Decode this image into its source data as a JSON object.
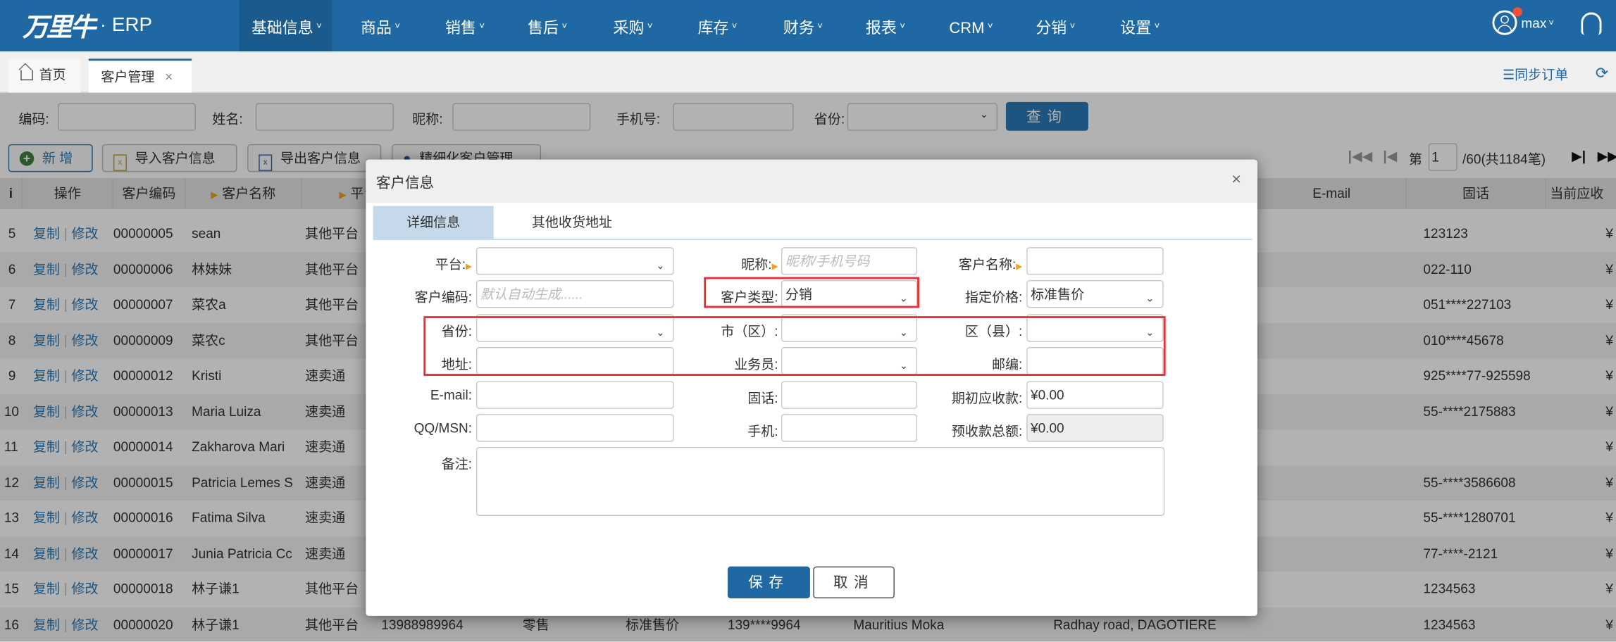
{
  "brand": {
    "logo_text": "万里牛",
    "suffix": "· ERP",
    "color": "#2068a3"
  },
  "nav": [
    {
      "label": "基础信息",
      "active": true
    },
    {
      "label": "商品"
    },
    {
      "label": "销售"
    },
    {
      "label": "售后"
    },
    {
      "label": "采购"
    },
    {
      "label": "库存"
    },
    {
      "label": "财务"
    },
    {
      "label": "报表"
    },
    {
      "label": "CRM"
    },
    {
      "label": "分销"
    },
    {
      "label": "设置"
    }
  ],
  "user": {
    "name": "max",
    "icon": "user-icon",
    "notification": true,
    "support_icon": "headset-icon"
  },
  "tabs": [
    {
      "label": "首页",
      "icon": "home-icon"
    },
    {
      "label": "客户管理",
      "active": true,
      "close": "×"
    }
  ],
  "tabbar_right": {
    "sync_label": "☰同步订单",
    "refresh_icon": "refresh-icon"
  },
  "search": {
    "code_label": "编码:",
    "name_label": "姓名:",
    "nick_label": "昵称:",
    "phone_label": "手机号:",
    "province_label": "省份:",
    "query_button": "查询"
  },
  "toolbar": {
    "add": "新 增",
    "import": "导入客户信息",
    "export": "导出客户信息",
    "fine": "精细化客户管理"
  },
  "pager": {
    "prefix": "第",
    "page": "1",
    "suffix": "/60(共1184笔)"
  },
  "table": {
    "headers": {
      "i": "i",
      "ops": "操作",
      "code": "客户编码",
      "name": "客户名称",
      "platform": "平台",
      "email": "E-mail",
      "tel": "固话",
      "receivable": "当前应收"
    },
    "copy_label": "复制",
    "edit_label": "修改",
    "rows": [
      {
        "i": "5",
        "code": "00000005",
        "name": "sean",
        "platform": "其他平台",
        "tel": "123123",
        "receivable": "¥"
      },
      {
        "i": "6",
        "code": "00000006",
        "name": "林妹妹",
        "platform": "其他平台",
        "tel": "022-110",
        "receivable": "¥"
      },
      {
        "i": "7",
        "code": "00000007",
        "name": "菜农a",
        "platform": "其他平台",
        "tel": "051****227103",
        "receivable": "¥"
      },
      {
        "i": "8",
        "code": "00000009",
        "name": "菜农c",
        "platform": "其他平台",
        "tel": "010****45678",
        "receivable": "¥"
      },
      {
        "i": "9",
        "code": "00000012",
        "name": "Kristi",
        "platform": "速卖通",
        "tel": "925****77-925598",
        "receivable": "¥"
      },
      {
        "i": "10",
        "code": "00000013",
        "name": "Maria Luiza",
        "platform": "速卖通",
        "tel": "55-****2175883",
        "receivable": "¥"
      },
      {
        "i": "11",
        "code": "00000014",
        "name": "Zakharova Mari",
        "platform": "速卖通",
        "tel": "",
        "receivable": "¥"
      },
      {
        "i": "12",
        "code": "00000015",
        "name": "Patricia Lemes S",
        "platform": "速卖通",
        "tel": "55-****3586608",
        "receivable": "¥"
      },
      {
        "i": "13",
        "code": "00000016",
        "name": "Fatima Silva",
        "platform": "速卖通",
        "tel": "55-****1280701",
        "receivable": "¥"
      },
      {
        "i": "14",
        "code": "00000017",
        "name": "Junia Patricia Cc",
        "platform": "速卖通",
        "tel": "77-****-2121",
        "receivable": "¥"
      },
      {
        "i": "15",
        "code": "00000018",
        "name": "林子谦1",
        "platform": "其他平台",
        "tel": "1234563",
        "receivable": "¥"
      },
      {
        "i": "16",
        "code": "00000020",
        "name": "林子谦1",
        "platform": "其他平台",
        "phone": "13988989964",
        "type": "零售",
        "price": "标准售价",
        "mobile": "139****9964",
        "region": "Mauritius Moka",
        "address": "Radhay road, DAGOTIERE",
        "tel": "1234563",
        "receivable": "¥"
      }
    ]
  },
  "dialog": {
    "title": "客户信息",
    "close": "×",
    "tabs": [
      {
        "label": "详细信息",
        "active": true
      },
      {
        "label": "其他收货地址"
      }
    ],
    "fields": {
      "platform": {
        "label": "平台:",
        "value": "",
        "required": true
      },
      "nickname": {
        "label": "昵称:",
        "placeholder": "昵称/手机号码",
        "required": true
      },
      "customer_name": {
        "label": "客户名称:",
        "value": "",
        "required": true
      },
      "customer_code": {
        "label": "客户编码:",
        "placeholder": "默认自动生成......"
      },
      "customer_type": {
        "label": "客户类型:",
        "value": "分销"
      },
      "price": {
        "label": "指定价格:",
        "value": "标准售价"
      },
      "province": {
        "label": "省份:",
        "value": ""
      },
      "city": {
        "label": "市（区）:",
        "value": ""
      },
      "district": {
        "label": "区（县）:",
        "value": ""
      },
      "address": {
        "label": "地址:",
        "value": ""
      },
      "salesman": {
        "label": "业务员:",
        "value": ""
      },
      "zipcode": {
        "label": "邮编:",
        "value": ""
      },
      "email": {
        "label": "E-mail:",
        "value": ""
      },
      "tel": {
        "label": "固话:",
        "value": ""
      },
      "initial_receivable": {
        "label": "期初应收款:",
        "value": "¥0.00"
      },
      "qq": {
        "label": "QQ/MSN:",
        "value": ""
      },
      "mobile": {
        "label": "手机:",
        "value": ""
      },
      "prepaid_total": {
        "label": "预收款总额:",
        "value": "¥0.00",
        "disabled": true
      },
      "remark": {
        "label": "备注:",
        "value": ""
      }
    },
    "save": "保存",
    "cancel": "取消",
    "highlight_color": "#e8323a"
  }
}
